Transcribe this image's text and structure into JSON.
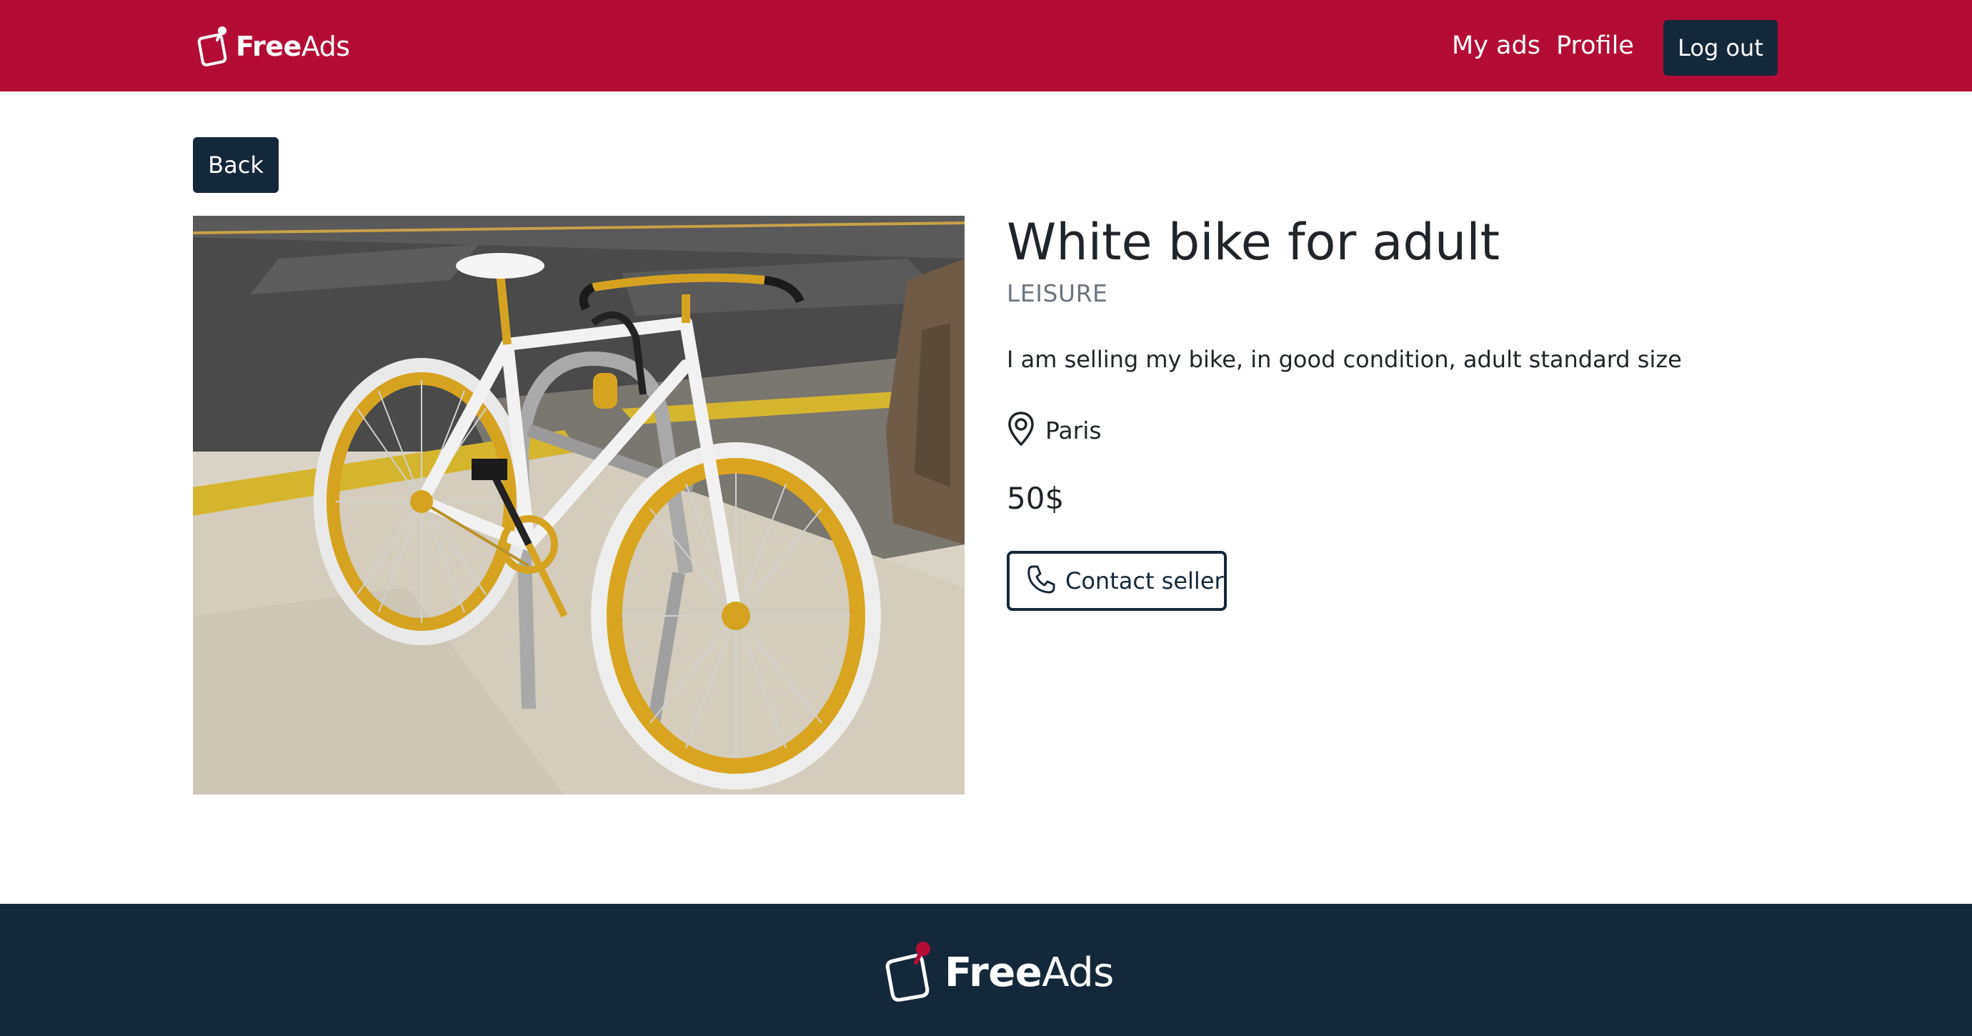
{
  "header": {
    "brand": {
      "bold": "Free",
      "regular": "Ads"
    },
    "nav": {
      "my_ads": "My ads",
      "profile": "Profile"
    },
    "logout_label": "Log out"
  },
  "main": {
    "back_label": "Back",
    "ad": {
      "title": "White bike for adult",
      "category": "LEISURE",
      "description": "I am selling my bike, in good condition, adult standard size",
      "location": "Paris",
      "price": "50$",
      "contact_label": "Contact seller"
    }
  },
  "footer": {
    "brand": {
      "bold": "Free",
      "regular": "Ads"
    }
  },
  "colors": {
    "header_bg": "#b30d36",
    "dark": "#15283a",
    "muted": "#6c757d",
    "accent_pin": "#b30d36"
  },
  "icons": {
    "brand_logo": "pushpin-note-icon",
    "location": "map-pin-icon",
    "contact": "phone-icon"
  }
}
